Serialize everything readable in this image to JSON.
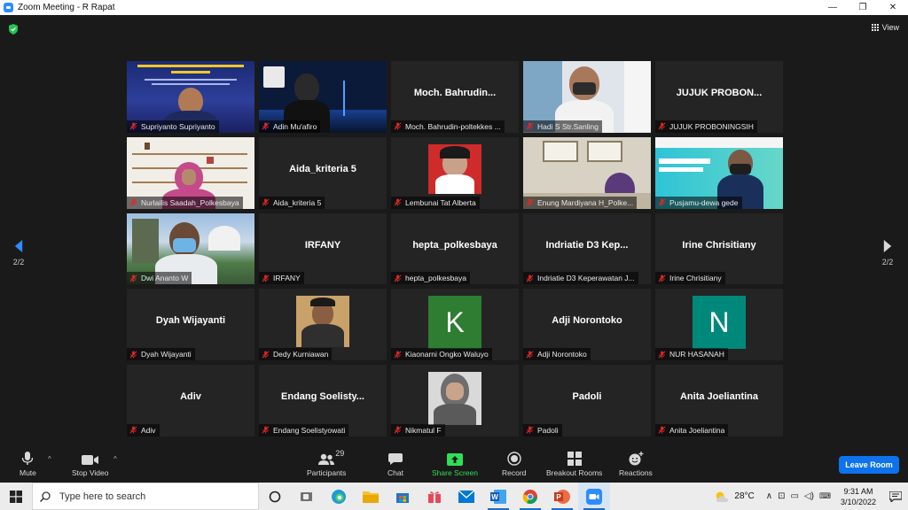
{
  "window": {
    "title": "Zoom Meeting - R Rapat",
    "minimize": "—",
    "restore": "❐",
    "close": "✕"
  },
  "header": {
    "view_label": "View"
  },
  "navigation": {
    "prev_page": "2/2",
    "next_page": "2/2"
  },
  "participants": [
    {
      "tile_name": "",
      "label": "Supriyanto Supriyanto",
      "video": "banner-blue"
    },
    {
      "tile_name": "",
      "label": "Adin Mu'afiro",
      "video": "night-city"
    },
    {
      "tile_name": "Moch. Bahrudin...",
      "label": "Moch. Bahrudin-poltekkes ...",
      "video": ""
    },
    {
      "tile_name": "",
      "label": "Hadi S Str.Sanling",
      "video": "office-mask"
    },
    {
      "tile_name": "JUJUK PROBON...",
      "label": "JUJUK PROBONINGSIH",
      "video": ""
    },
    {
      "tile_name": "",
      "label": "Nurlailis Saadah_Polkesbaya",
      "video": "bookshelf"
    },
    {
      "tile_name": "Aida_kriteria 5",
      "label": "Aida_kriteria 5",
      "video": ""
    },
    {
      "tile_name": "",
      "label": "Lembunai Tat Alberta",
      "video": "photo-id"
    },
    {
      "tile_name": "",
      "label": "Enung Mardiyana H_Polke...",
      "video": "room-window"
    },
    {
      "tile_name": "",
      "label": "Pusjamu-dewa gede",
      "video": "banner-teal"
    },
    {
      "tile_name": "",
      "label": "Dwi Ananto W",
      "video": "outdoor-mask"
    },
    {
      "tile_name": "IRFANY",
      "label": "IRFANY",
      "video": ""
    },
    {
      "tile_name": "hepta_polkesbaya",
      "label": "hepta_polkesbaya",
      "video": ""
    },
    {
      "tile_name": "Indriatie D3 Kep...",
      "label": "Indriatie D3 Keperawatan J...",
      "video": ""
    },
    {
      "tile_name": "Irine Chrisitiany",
      "label": "Irine Chrisitiany",
      "video": ""
    },
    {
      "tile_name": "Dyah Wijayanti",
      "label": "Dyah Wijayanti",
      "video": ""
    },
    {
      "tile_name": "",
      "label": "Dedy Kurniawan",
      "video": "photo-portrait"
    },
    {
      "tile_name": "",
      "label": "Kiaonarni Ongko Waluyo",
      "video": "",
      "avatar_letter": "K",
      "avatar_color": "#2e7d32"
    },
    {
      "tile_name": "Adji Norontoko",
      "label": "Adji Norontoko",
      "video": ""
    },
    {
      "tile_name": "",
      "label": "NUR HASANAH",
      "video": "",
      "avatar_letter": "N",
      "avatar_color": "#00897b"
    },
    {
      "tile_name": "Adiv",
      "label": "Adiv",
      "video": ""
    },
    {
      "tile_name": "Endang Soelisty...",
      "label": "Endang Soelistyowati",
      "video": ""
    },
    {
      "tile_name": "",
      "label": "Nikmatul F",
      "video": "photo-hijab"
    },
    {
      "tile_name": "Padoli",
      "label": "Padoli",
      "video": ""
    },
    {
      "tile_name": "Anita Joeliantina",
      "label": "Anita Joeliantina",
      "video": ""
    }
  ],
  "toolbar": {
    "mute": "Mute",
    "stop_video": "Stop Video",
    "participants": "Participants",
    "participants_count": "29",
    "chat": "Chat",
    "share_screen": "Share Screen",
    "record": "Record",
    "breakout_rooms": "Breakout Rooms",
    "reactions": "Reactions",
    "leave": "Leave Room"
  },
  "taskbar": {
    "search_placeholder": "Type here to search",
    "temperature": "28°C",
    "time": "9:31 AM",
    "date": "3/10/2022"
  },
  "colors": {
    "accent_blue": "#0e72ed",
    "share_green": "#2ee057",
    "muted_red": "#e02828"
  }
}
